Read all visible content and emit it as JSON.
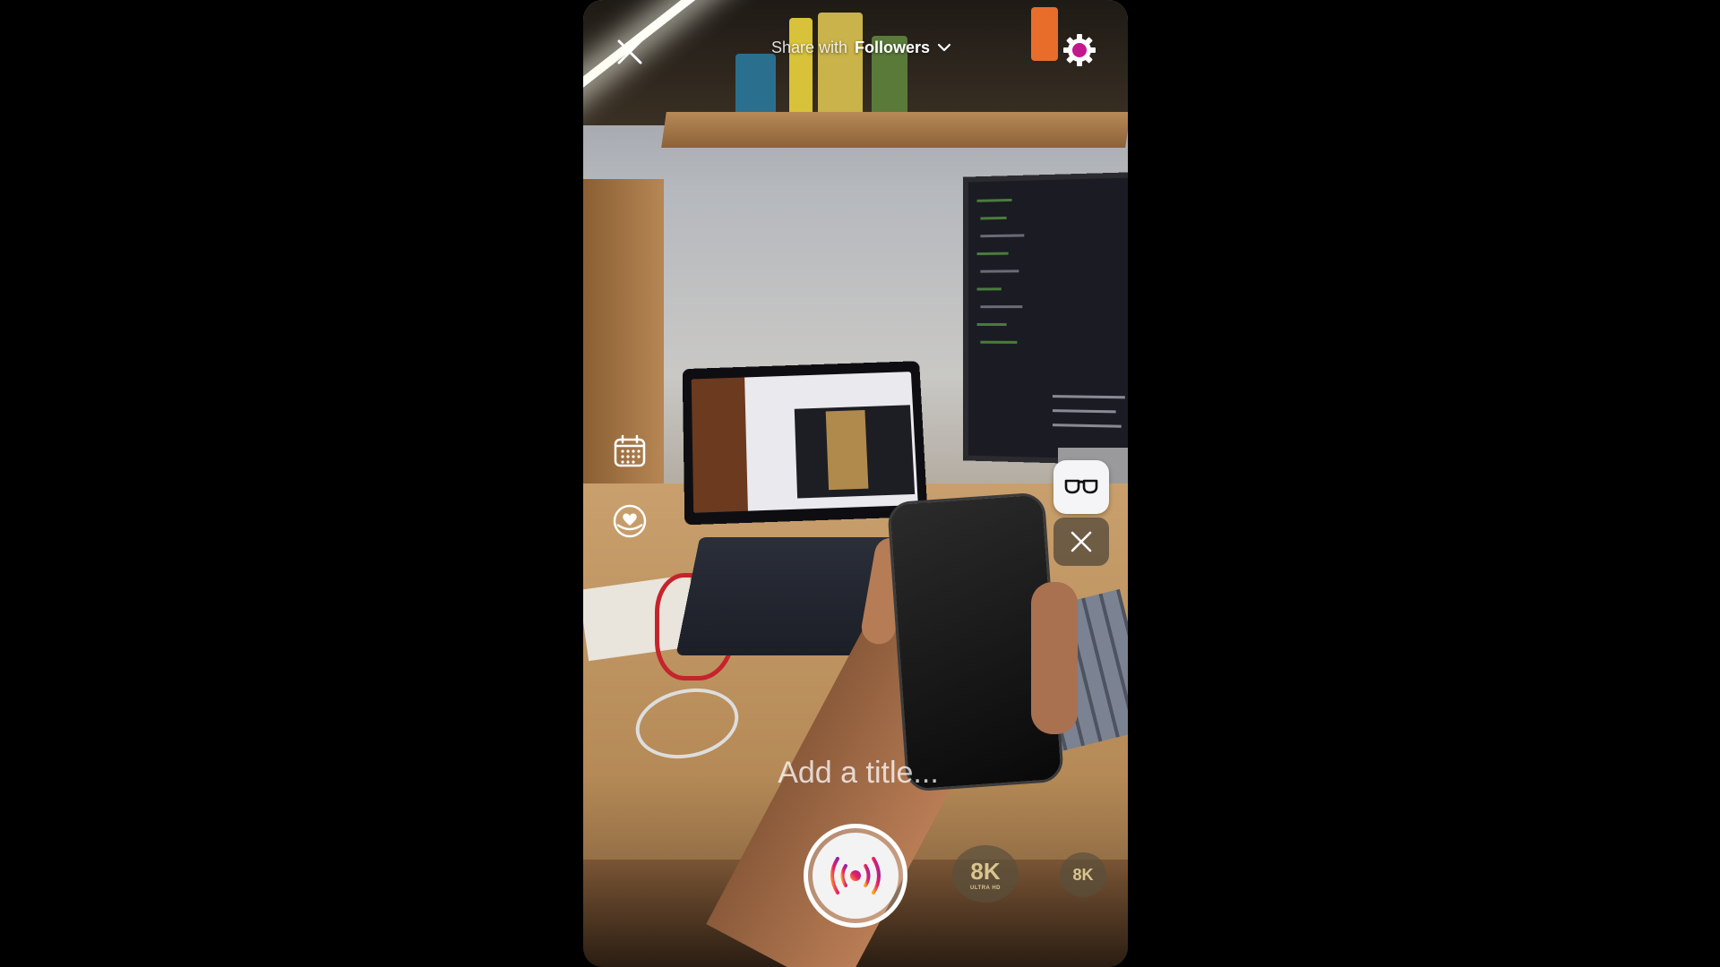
{
  "top_bar": {
    "share_prefix": "Share with",
    "share_audience": "Followers"
  },
  "title_input": {
    "placeholder": "Add a title...",
    "value": ""
  },
  "badges": {
    "large_label": "8K",
    "large_sub": "ULTRA HD",
    "small_label": "8K"
  },
  "icons": {
    "close": "close-icon",
    "chevron": "chevron-down-icon",
    "settings": "gear-icon",
    "schedule": "calendar-icon",
    "fundraiser": "heart-badge-icon",
    "glasses": "glasses-icon",
    "dismiss": "close-icon",
    "live": "live-broadcast-icon"
  },
  "colors": {
    "live_gradient": [
      "#f9a825",
      "#e91e63",
      "#8e24aa"
    ],
    "ui_white": "#ffffff"
  }
}
